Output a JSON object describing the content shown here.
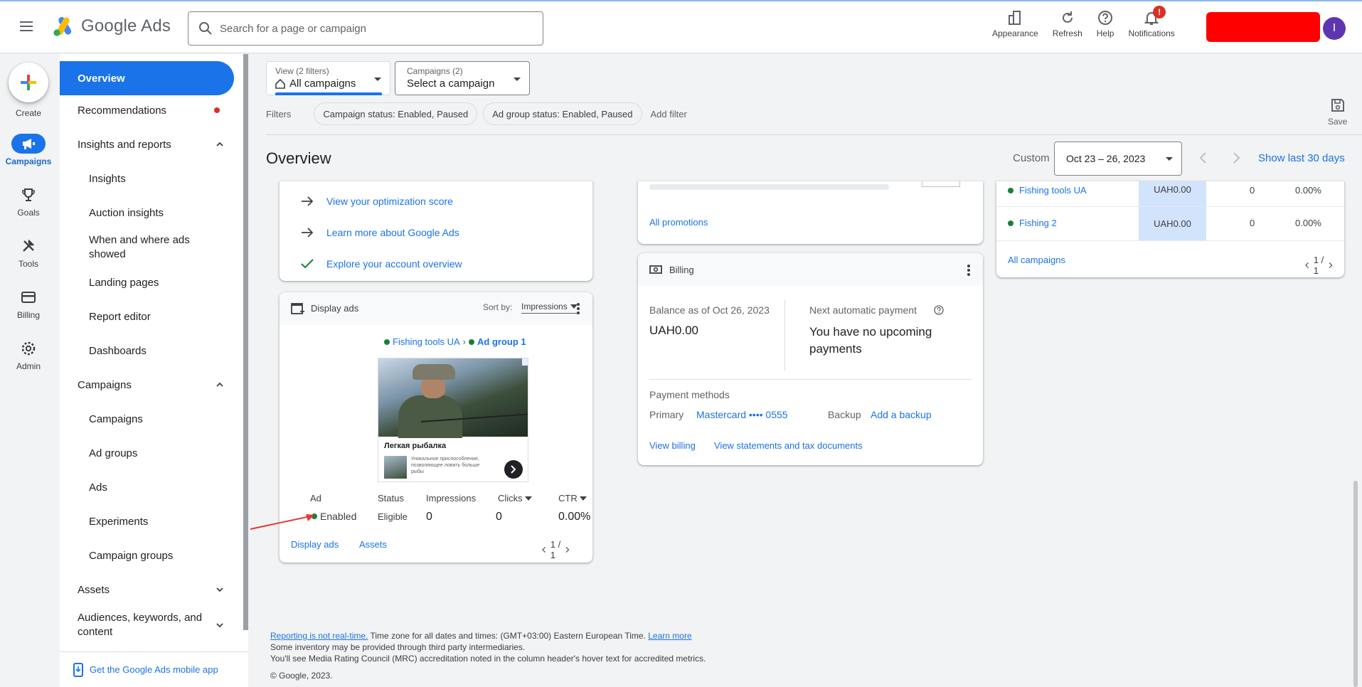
{
  "app": {
    "name": "Google Ads"
  },
  "search": {
    "placeholder": "Search for a page or campaign"
  },
  "top_actions": [
    {
      "label": "Appearance",
      "icon": "appearance-icon"
    },
    {
      "label": "Refresh",
      "icon": "refresh-icon"
    },
    {
      "label": "Help",
      "icon": "help-icon"
    },
    {
      "label": "Notifications",
      "icon": "bell-icon",
      "badge": "!"
    }
  ],
  "avatar": {
    "initial": "I"
  },
  "rail": [
    {
      "label": "Create",
      "icon": "plus-icon"
    },
    {
      "label": "Campaigns",
      "icon": "megaphone-icon",
      "active": true
    },
    {
      "label": "Goals",
      "icon": "trophy-icon"
    },
    {
      "label": "Tools",
      "icon": "tools-icon"
    },
    {
      "label": "Billing",
      "icon": "card-icon"
    },
    {
      "label": "Admin",
      "icon": "gear-icon"
    }
  ],
  "nav": {
    "overview": "Overview",
    "recommendations": "Recommendations",
    "insights_reports": "Insights and reports",
    "insights": "Insights",
    "auction_insights": "Auction insights",
    "when_where": "When and where ads showed",
    "landing_pages": "Landing pages",
    "report_editor": "Report editor",
    "dashboards": "Dashboards",
    "campaigns_section": "Campaigns",
    "campaigns": "Campaigns",
    "ad_groups": "Ad groups",
    "ads": "Ads",
    "experiments": "Experiments",
    "campaign_groups": "Campaign groups",
    "assets": "Assets",
    "audiences": "Audiences, keywords, and content",
    "mobile_app": "Get the Google Ads mobile app"
  },
  "view_selector": {
    "label": "View (2 filters)",
    "value": "All campaigns"
  },
  "campaign_selector": {
    "label": "Campaigns (2)",
    "value": "Select a campaign"
  },
  "filters": {
    "label": "Filters",
    "chips": [
      "Campaign status: Enabled, Paused",
      "Ad group status: Enabled, Paused"
    ],
    "add": "Add filter"
  },
  "save": {
    "label": "Save"
  },
  "page_title": "Overview",
  "date": {
    "custom": "Custom",
    "range": "Oct 23 – 26, 2023",
    "show_last": "Show last 30 days"
  },
  "optimization": {
    "links": [
      "View your optimization score",
      "Learn more about Google Ads",
      "Explore your account overview"
    ]
  },
  "display_ads": {
    "title": "Display ads",
    "sort_label": "Sort by:",
    "sort_value": "Impressions",
    "campaign": "Fishing tools UA",
    "ad_group": "Ad group 1",
    "ad_heading": "Легкая рыбалка",
    "ad_desc": "Уникальное приспособление, позволяющее ловить больше рыбы",
    "columns": {
      "ad": "Ad",
      "status": "Status",
      "impressions": "Impressions",
      "clicks": "Clicks",
      "ctr": "CTR"
    },
    "row": {
      "ad": "Enabled",
      "status": "Eligible",
      "impressions": "0",
      "clicks": "0",
      "ctr": "0.00%"
    },
    "footer_links": [
      "Display ads",
      "Assets"
    ],
    "pager": "1 / 1"
  },
  "promotions": {
    "link": "All promotions"
  },
  "billing": {
    "title": "Billing",
    "balance_label": "Balance as of Oct 26, 2023",
    "balance_value": "UAH0.00",
    "next_label": "Next automatic payment",
    "next_value": "You have no upcoming payments",
    "methods_label": "Payment methods",
    "primary_label": "Primary",
    "primary_value": "Mastercard •••• 0555",
    "backup_label": "Backup",
    "backup_value": "Add a backup",
    "links": [
      "View billing",
      "View statements and tax documents"
    ]
  },
  "campaigns_table": {
    "rows": [
      {
        "name": "Fishing tools UA",
        "cost": "UAH0.00",
        "clicks": "0",
        "ctr": "0.00%"
      },
      {
        "name": "Fishing 2",
        "cost": "UAH0.00",
        "clicks": "0",
        "ctr": "0.00%"
      }
    ],
    "link": "All campaigns",
    "pager": "1 / 1"
  },
  "footer": {
    "realtime_link": "Reporting is not real-time.",
    "timezone": " Time zone for all dates and times: (GMT+03:00) Eastern European Time. ",
    "learn_more": "Learn more",
    "line2": "Some inventory may be provided through third party intermediaries.",
    "line3": "You'll see Media Rating Council (MRC) accreditation noted in the column header's hover text for accredited metrics.",
    "copyright": "© Google, 2023."
  },
  "colors": {
    "primary": "#1a73e8",
    "enabled": "#188038",
    "alert": "#d93025",
    "redaction": "#ff0000",
    "annotation": "#e53935"
  }
}
